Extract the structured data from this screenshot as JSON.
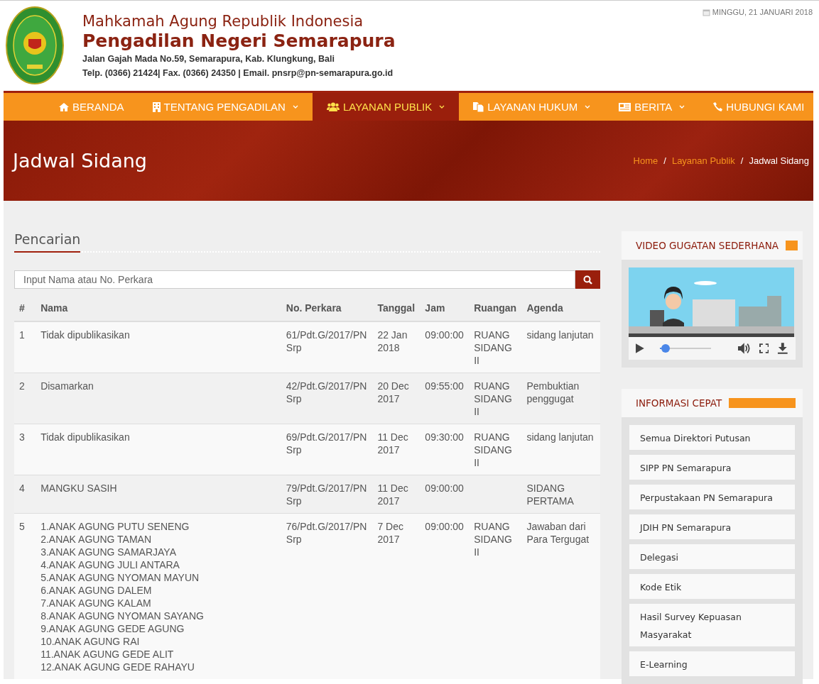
{
  "header": {
    "institution": "Mahkamah Agung Republik Indonesia",
    "court": "Pengadilan Negeri Semarapura",
    "address": "Jalan Gajah Mada No.59, Semarapura, Kab. Klungkung, Bali",
    "contact": "Telp. (0366) 21424| Fax. (0366) 24350 | Email. pnsrp@pn-semarapura.go.id",
    "date": "MINGGU, 21 JANUARI 2018"
  },
  "nav": {
    "items": [
      {
        "label": "BERANDA",
        "dropdown": false,
        "selected": false
      },
      {
        "label": "TENTANG PENGADILAN",
        "dropdown": true,
        "selected": false
      },
      {
        "label": "LAYANAN PUBLIK",
        "dropdown": true,
        "selected": true
      },
      {
        "label": "LAYANAN HUKUM",
        "dropdown": true,
        "selected": false
      },
      {
        "label": "BERITA",
        "dropdown": true,
        "selected": false
      },
      {
        "label": "HUBUNGI KAMI",
        "dropdown": false,
        "selected": false
      }
    ]
  },
  "banner": {
    "title": "Jadwal Sidang",
    "breadcrumb": [
      {
        "label": "Home",
        "kind": "link"
      },
      {
        "label": "/",
        "kind": "separator"
      },
      {
        "label": "Layanan Publik",
        "kind": "link"
      },
      {
        "label": "/",
        "kind": "separator"
      },
      {
        "label": "Jadwal Sidang",
        "kind": "current"
      }
    ]
  },
  "search": {
    "heading": "Pencarian",
    "placeholder": "Input Nama atau No. Perkara"
  },
  "table": {
    "columns": [
      "#",
      "Nama",
      "No. Perkara",
      "Tanggal",
      "Jam",
      "Ruangan",
      "Agenda"
    ],
    "rows": [
      [
        "1",
        "Tidak dipublikasikan",
        "61/Pdt.G/2017/PN Srp",
        "22 Jan 2018",
        "09:00:00",
        "RUANG SIDANG II",
        "sidang lanjutan"
      ],
      [
        "2",
        "Disamarkan",
        "42/Pdt.G/2017/PN Srp",
        "20 Dec 2017",
        "09:55:00",
        "RUANG SIDANG II",
        "Pembuktian penggugat"
      ],
      [
        "3",
        "Tidak dipublikasikan",
        "69/Pdt.G/2017/PN Srp",
        "11 Dec 2017",
        "09:30:00",
        "RUANG SIDANG II",
        "sidang lanjutan"
      ],
      [
        "4",
        "MANGKU SASIH",
        "79/Pdt.G/2017/PN Srp",
        "11 Dec 2017",
        "09:00:00",
        "",
        "SIDANG PERTAMA"
      ],
      [
        "5",
        "1.ANAK AGUNG PUTU SENENG\n2.ANAK AGUNG TAMAN\n3.ANAK AGUNG SAMARJAYA\n4.ANAK AGUNG JULI ANTARA\n5.ANAK AGUNG NYOMAN MAYUN\n6.ANAK AGUNG DALEM\n7.ANAK AGUNG KALAM\n8.ANAK AGUNG NYOMAN SAYANG\n9.ANAK AGUNG GEDE AGUNG\n10.ANAK AGUNG RAI\n11.ANAK AGUNG GEDE ALIT\n12.ANAK AGUNG GEDE RAHAYU",
        "76/Pdt.G/2017/PN Srp",
        "7 Dec 2017",
        "09:00:00",
        "RUANG SIDANG II",
        "Jawaban dari Para Tergugat"
      ]
    ]
  },
  "sidebar": {
    "video": {
      "title": "VIDEO GUGATAN SEDERHANA",
      "progress": {
        "level": 0.03
      }
    },
    "quick_info": {
      "title": "INFORMASI CEPAT",
      "links": [
        "Semua Direktori Putusan",
        "SIPP PN Semarapura",
        "Perpustakaan PN Semarapura",
        "JDIH PN Semarapura",
        "Delegasi",
        "Kode Etik",
        "Hasil Survey Kepuasan Masyarakat",
        "E-Learning"
      ]
    }
  }
}
